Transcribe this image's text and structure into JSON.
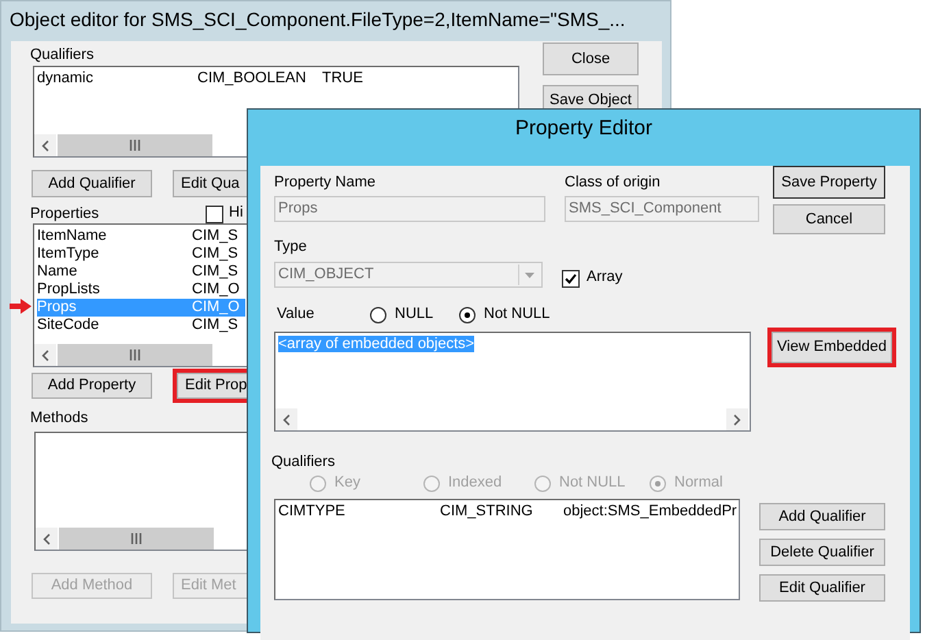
{
  "object_editor": {
    "title": "Object editor for SMS_SCI_Component.FileType=2,ItemName=\"SMS_...",
    "side_buttons": [
      {
        "label": "Close"
      },
      {
        "label": "Save Object"
      }
    ],
    "qualifiers": {
      "label": "Qualifiers",
      "rows": [
        {
          "name": "dynamic",
          "type": "CIM_BOOLEAN",
          "value": "TRUE"
        }
      ],
      "buttons": [
        {
          "label": "Add Qualifier",
          "disabled": false,
          "highlighted": false
        },
        {
          "label": "Edit Qua",
          "disabled": false,
          "highlighted": false
        }
      ]
    },
    "properties": {
      "label": "Properties",
      "hide_checkbox": {
        "label": "Hi",
        "checked": false
      },
      "rows": [
        {
          "name": "ItemName",
          "type": "CIM_S",
          "selected": false,
          "pointed": false
        },
        {
          "name": "ItemType",
          "type": "CIM_S",
          "selected": false,
          "pointed": false
        },
        {
          "name": "Name",
          "type": "CIM_S",
          "selected": false,
          "pointed": false
        },
        {
          "name": "PropLists",
          "type": "CIM_O",
          "selected": false,
          "pointed": false
        },
        {
          "name": "Props",
          "type": "CIM_O",
          "selected": true,
          "pointed": true
        },
        {
          "name": "SiteCode",
          "type": "CIM_S",
          "selected": false,
          "pointed": false
        }
      ],
      "buttons": [
        {
          "label": "Add Property",
          "disabled": false,
          "highlighted": false
        },
        {
          "label": "Edit Prop",
          "disabled": false,
          "highlighted": true
        }
      ]
    },
    "methods": {
      "label": "Methods",
      "buttons": [
        {
          "label": "Add Method",
          "disabled": true,
          "highlighted": false
        },
        {
          "label": "Edit Met",
          "disabled": true,
          "highlighted": false
        }
      ]
    }
  },
  "property_editor": {
    "title": "Property Editor",
    "property_name": {
      "label": "Property Name",
      "value": "Props",
      "disabled": true
    },
    "class_of_origin": {
      "label": "Class of origin",
      "value": "SMS_SCI_Component",
      "disabled": true
    },
    "buttons": [
      {
        "label": "Save Property",
        "disabled": false,
        "highlighted": false
      },
      {
        "label": "Cancel",
        "disabled": false,
        "highlighted": false
      }
    ],
    "type": {
      "label": "Type",
      "value": "CIM_OBJECT",
      "disabled": true
    },
    "array": {
      "label": "Array",
      "checked": true
    },
    "value": {
      "label": "Value",
      "options": [
        {
          "label": "NULL",
          "selected": false
        },
        {
          "label": "Not NULL",
          "selected": true
        }
      ],
      "text": "<array of embedded objects>",
      "text_selected": true
    },
    "view_embedded": {
      "label": "View Embedded",
      "disabled": false,
      "highlighted": true
    },
    "qualifiers": {
      "label": "Qualifiers",
      "flavors": [
        {
          "label": "Key",
          "selected": false,
          "disabled": true
        },
        {
          "label": "Indexed",
          "selected": false,
          "disabled": true
        },
        {
          "label": "Not NULL",
          "selected": false,
          "disabled": true
        },
        {
          "label": "Normal",
          "selected": true,
          "disabled": true
        }
      ],
      "rows": [
        {
          "name": "CIMTYPE",
          "type": "CIM_STRING",
          "value": "object:SMS_EmbeddedPr"
        }
      ],
      "buttons": [
        {
          "label": "Add Qualifier",
          "disabled": false,
          "highlighted": false
        },
        {
          "label": "Delete Qualifier",
          "disabled": false,
          "highlighted": false
        },
        {
          "label": "Edit Qualifier",
          "disabled": false,
          "highlighted": false
        }
      ]
    }
  }
}
